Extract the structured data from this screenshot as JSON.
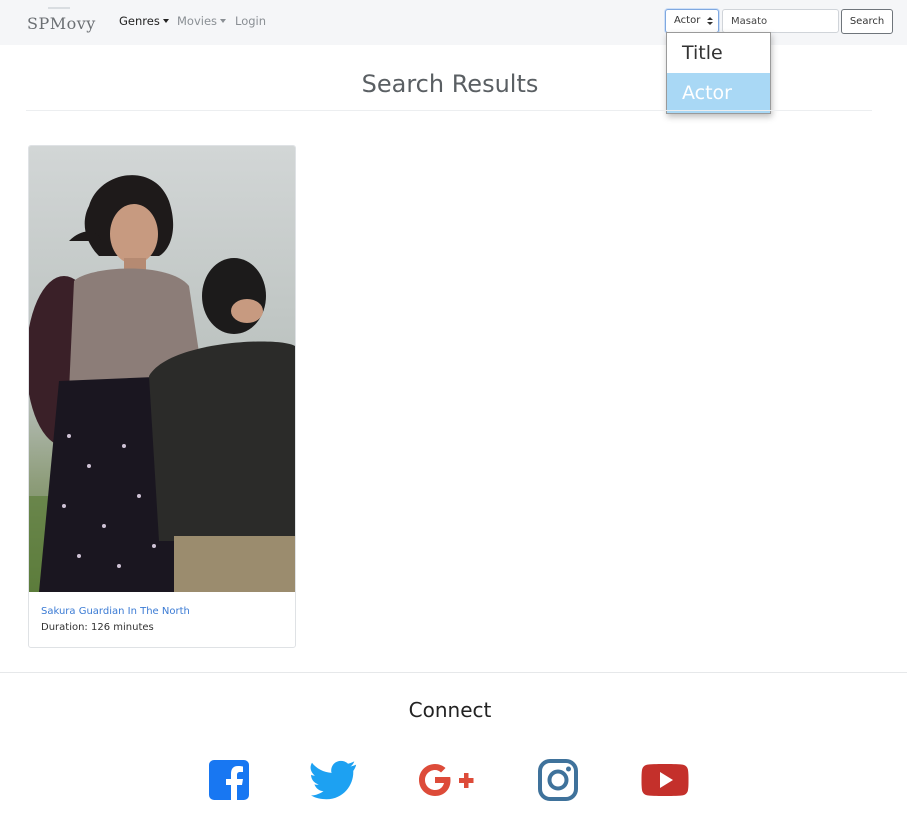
{
  "navbar": {
    "brand": "SPMovy",
    "genres_label": "Genres",
    "movies_label": "Movies",
    "login_label": "Login",
    "search_type_value": "Actor",
    "search_value": "Masato",
    "search_button": "Search"
  },
  "dropdown": {
    "options": [
      "Title",
      "Actor"
    ],
    "selected": "Actor"
  },
  "main": {
    "heading": "Search Results",
    "results": [
      {
        "title": "Sakura Guardian In The North",
        "duration": "Duration: 126 minutes"
      }
    ]
  },
  "footer": {
    "heading": "Connect",
    "social": [
      "facebook-icon",
      "twitter-icon",
      "google-plus-icon",
      "instagram-icon",
      "youtube-icon"
    ]
  },
  "colors": {
    "link": "#3b7bd4",
    "selected_option": "#a9d8f5",
    "facebook": "#1877f2",
    "twitter": "#1da1f2",
    "google_plus": "#dd4b39",
    "instagram": "#3f729b",
    "youtube": "#c4302b"
  }
}
